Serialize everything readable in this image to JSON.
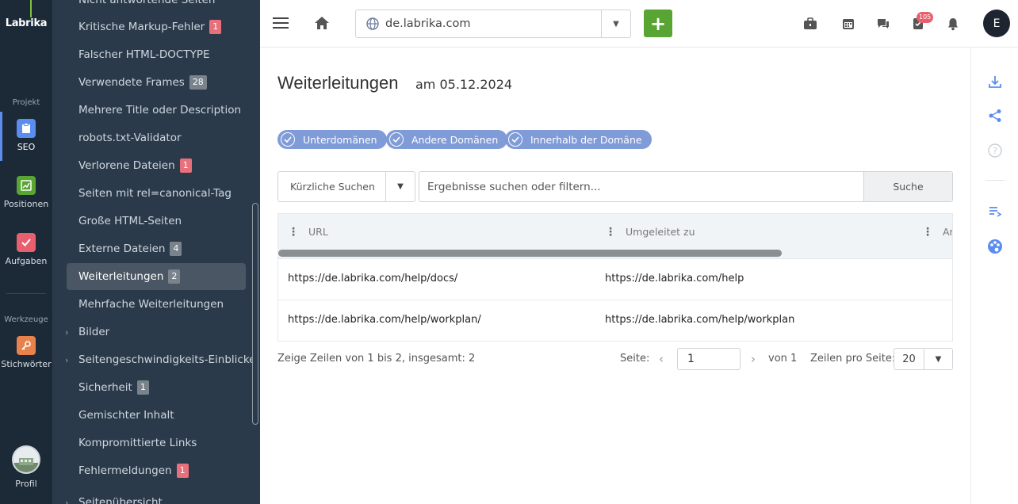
{
  "brand": {
    "logo_text": "Labrika",
    "accent": "#7cc242"
  },
  "rail": {
    "section_project": "Projekt",
    "section_tools": "Werkzeuge",
    "items": [
      {
        "label": "SEO",
        "icon": "seo-clipboard-icon",
        "color": "#5b8def"
      },
      {
        "label": "Positionen",
        "icon": "chart-icon",
        "color": "#58a533"
      },
      {
        "label": "Aufgaben",
        "icon": "checkmark-icon",
        "color": "#e8606d"
      },
      {
        "label": "Stichwörter",
        "icon": "key-icon",
        "color": "#e8824d"
      }
    ],
    "profile_label": "Profil"
  },
  "submenu": {
    "items": [
      {
        "label": "Nicht antwortende Seiten",
        "badge": ""
      },
      {
        "label": "Kritische Markup-Fehler",
        "badge": "1",
        "badge_color": "red"
      },
      {
        "label": "Falscher HTML-DOCTYPE",
        "badge": ""
      },
      {
        "label": "Verwendete Frames",
        "badge": "28",
        "badge_color": "gray"
      },
      {
        "label": "Mehrere Title oder Description",
        "badge": ""
      },
      {
        "label": "robots.txt-Validator",
        "badge": ""
      },
      {
        "label": "Verlorene Dateien",
        "badge": "1",
        "badge_color": "red"
      },
      {
        "label": "Seiten mit rel=canonical-Tag",
        "badge": ""
      },
      {
        "label": "Große HTML-Seiten",
        "badge": ""
      },
      {
        "label": "Externe Dateien",
        "badge": "4",
        "badge_color": "gray"
      },
      {
        "label": "Weiterleitungen",
        "badge": "2",
        "badge_color": "gray",
        "active": true
      },
      {
        "label": "Mehrfache Weiterleitungen",
        "badge": ""
      },
      {
        "label": "Bilder",
        "badge": "",
        "expandable": true
      },
      {
        "label": "Seitengeschwindigkeits-Einblicke",
        "badge": "",
        "expandable": true
      },
      {
        "label": "Sicherheit",
        "badge": "1",
        "badge_color": "gray"
      },
      {
        "label": "Gemischter Inhalt",
        "badge": ""
      },
      {
        "label": "Kompromittierte Links",
        "badge": ""
      },
      {
        "label": "Fehlermeldungen",
        "badge": "1",
        "badge_color": "red"
      },
      {
        "label": "Seitenübersicht",
        "badge": "",
        "expandable": true
      }
    ]
  },
  "header": {
    "domain": "de.labrika.com",
    "add_label": "+",
    "notifications_count": "105",
    "user_initial": "E"
  },
  "page": {
    "title": "Weiterleitungen",
    "date_label": "am 05.12.2024",
    "filters": [
      "Unterdomänen",
      "Andere Domänen",
      "Innerhalb der Domäne"
    ]
  },
  "search": {
    "recent_label": "Kürzliche Suchen",
    "placeholder": "Ergebnisse suchen oder filtern...",
    "button_label": "Suche"
  },
  "table": {
    "columns": [
      "URL",
      "Umgeleitet zu",
      "An"
    ],
    "rows": [
      [
        "https://de.labrika.com/help/docs/",
        "https://de.labrika.com/help"
      ],
      [
        "https://de.labrika.com/help/workplan/",
        "https://de.labrika.com/help/workplan"
      ]
    ]
  },
  "pagination": {
    "summary": "Zeige Zeilen von 1 bis 2, insgesamt: 2",
    "page_label": "Seite:",
    "current_page": "1",
    "of_label": "von 1",
    "rows_per_page_label": "Zeilen pro Seite:",
    "rows_per_page": "20"
  }
}
